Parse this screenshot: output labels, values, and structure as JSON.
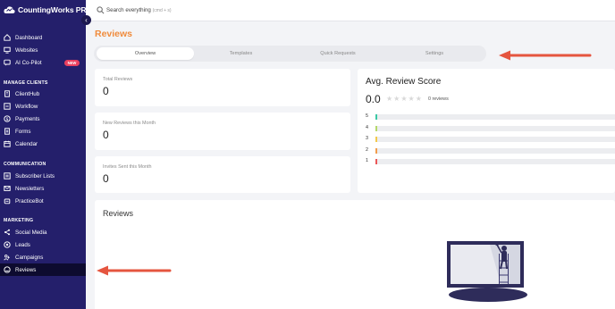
{
  "app": {
    "logo_text": "CountingWorks PRO"
  },
  "search": {
    "label": "Search everything",
    "hint": "(cmd + s)"
  },
  "sidebar": {
    "top_items": [
      {
        "label": "Dashboard",
        "icon": "home-icon"
      },
      {
        "label": "Websites",
        "icon": "monitor-icon"
      },
      {
        "label": "AI Co-Pilot",
        "icon": "chat-icon",
        "badge": "NEW"
      }
    ],
    "sections": {
      "manage_clients": "MANAGE CLIENTS",
      "communication": "COMMUNICATION",
      "marketing": "MARKETING"
    },
    "manage_items": [
      {
        "label": "ClientHub",
        "icon": "building-icon"
      },
      {
        "label": "Workflow",
        "icon": "workflow-icon"
      },
      {
        "label": "Payments",
        "icon": "dollar-icon"
      },
      {
        "label": "Forms",
        "icon": "form-icon"
      },
      {
        "label": "Calendar",
        "icon": "calendar-icon"
      }
    ],
    "communication_items": [
      {
        "label": "Subscriber Lists",
        "icon": "list-icon"
      },
      {
        "label": "Newsletters",
        "icon": "mail-icon"
      },
      {
        "label": "PracticeBot",
        "icon": "bot-icon"
      }
    ],
    "marketing_items": [
      {
        "label": "Social Media",
        "icon": "share-icon"
      },
      {
        "label": "Leads",
        "icon": "target-icon"
      },
      {
        "label": "Campaigns",
        "icon": "people-icon"
      },
      {
        "label": "Reviews",
        "icon": "smile-icon",
        "active": true
      }
    ]
  },
  "page": {
    "title": "Reviews"
  },
  "tabs": [
    {
      "label": "Overview",
      "active": true
    },
    {
      "label": "Templates"
    },
    {
      "label": "Quick Requests"
    },
    {
      "label": "Settings"
    }
  ],
  "stats": [
    {
      "label": "Total Reviews",
      "value": "0"
    },
    {
      "label": "New Reviews this Month",
      "value": "0"
    },
    {
      "label": "Invites Sent this Month",
      "value": "0"
    }
  ],
  "avg_review": {
    "title": "Avg. Review Score",
    "score": "0.0",
    "stars": "★★★★★",
    "count_text": "0 reviews",
    "rows": [
      {
        "label": "5",
        "color": "#3cc8a4"
      },
      {
        "label": "4",
        "color": "#b5d86a"
      },
      {
        "label": "3",
        "color": "#f2c94c"
      },
      {
        "label": "2",
        "color": "#f29d4c"
      },
      {
        "label": "1",
        "color": "#eb5757"
      }
    ]
  },
  "reviews_section": {
    "title": "Reviews"
  },
  "colors": {
    "sidebar": "#241f6b",
    "accent": "#f08b3c",
    "arrow": "#e5553f"
  }
}
